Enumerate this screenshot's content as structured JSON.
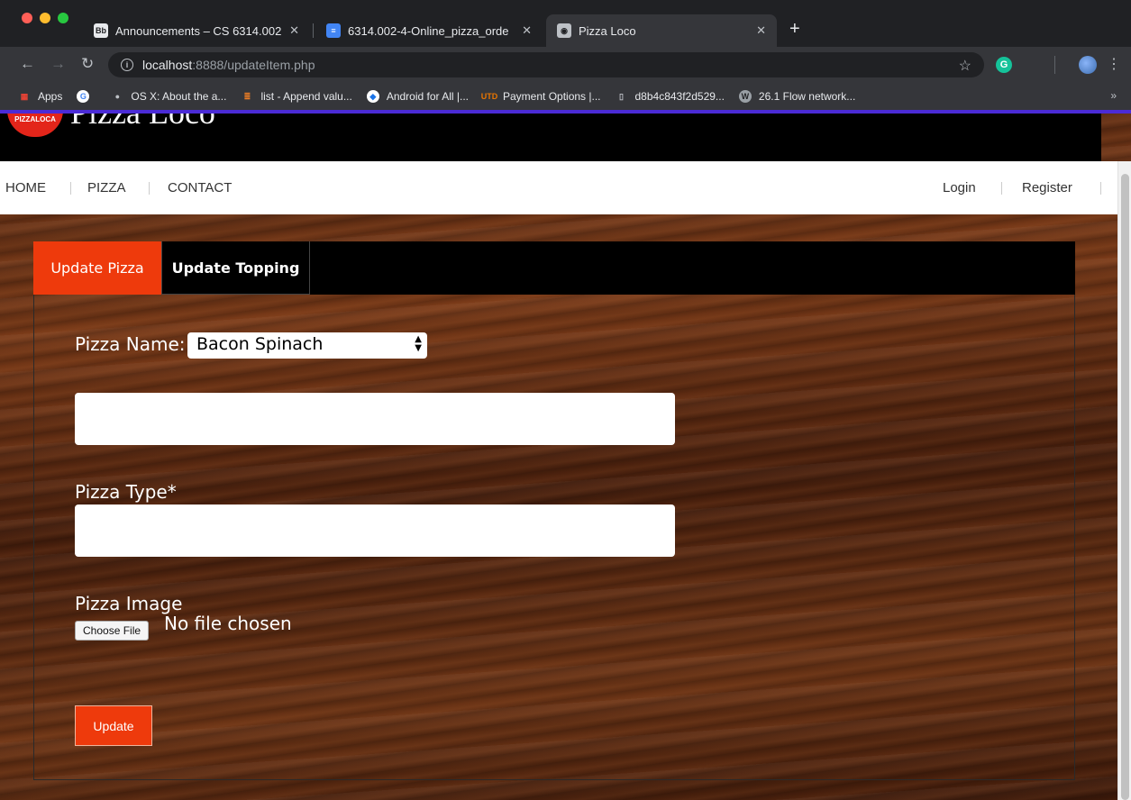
{
  "browser": {
    "tabs": [
      {
        "title": "Announcements – CS 6314.002",
        "favicon": "Bb"
      },
      {
        "title": "6314.002-4-Online_pizza_orde",
        "favicon": "docs-icon"
      },
      {
        "title": "Pizza Loco",
        "favicon": "pizza-icon",
        "active": true
      }
    ],
    "url_host": "localhost",
    "url_path": ":8888/updateItem.php",
    "bookmarks": [
      {
        "label": "Apps",
        "icon": "apps-grid-icon"
      },
      {
        "label": "",
        "icon": "google-icon"
      },
      {
        "label": "OS X: About the a...",
        "icon": "apple-icon"
      },
      {
        "label": "list - Append valu...",
        "icon": "stackoverflow-icon"
      },
      {
        "label": "Android for All |...",
        "icon": "android-icon"
      },
      {
        "label": "Payment Options |...",
        "icon": "utd-icon"
      },
      {
        "label": "d8b4c843f2d529...",
        "icon": "document-icon"
      },
      {
        "label": "26.1 Flow network...",
        "icon": "w-icon"
      }
    ],
    "extension_letter": "G"
  },
  "site": {
    "logo_text": "PIZZALOCA",
    "title": "Pizza Loco",
    "nav": {
      "home": "HOME",
      "pizza": "PIZZA",
      "contact": "CONTACT",
      "login": "Login",
      "register": "Register"
    }
  },
  "form": {
    "tabs": {
      "update_pizza": "Update Pizza",
      "update_topping": "Update Topping"
    },
    "pizza_name_label": "Pizza Name:",
    "pizza_name_value": "Bacon Spinach",
    "price_value": "",
    "pizza_type_label": "Pizza Type*",
    "pizza_type_value": "",
    "pizza_image_label": "Pizza Image",
    "choose_file_label": "Choose File",
    "file_status": "No file chosen",
    "update_label": "Update"
  },
  "colors": {
    "accent": "#ee3a0c",
    "header": "#000000",
    "loading_bar": "#4b2bd6"
  }
}
